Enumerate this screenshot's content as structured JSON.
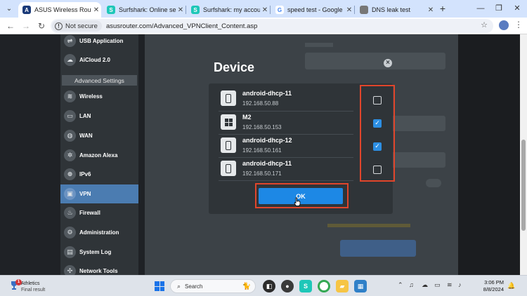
{
  "browser": {
    "tabs": [
      {
        "title": "ASUS Wireless Router RT",
        "active": true,
        "fav_color": "#1a3a78",
        "fav_text": "A"
      },
      {
        "title": "Surfshark: Online securit",
        "active": false,
        "fav_color": "#1ec7b8",
        "fav_text": "S"
      },
      {
        "title": "Surfshark: my account",
        "active": false,
        "fav_color": "#1ec7b8",
        "fav_text": "S"
      },
      {
        "title": "speed test - Google Sea",
        "active": false,
        "fav_color": "#4285f4",
        "fav_text": "G"
      },
      {
        "title": "DNS leak test",
        "active": false,
        "fav_color": "#777777",
        "fav_text": ""
      }
    ],
    "not_secure_label": "Not secure",
    "url": "asusrouter.com/Advanced_VPNClient_Content.asp"
  },
  "sidebar": {
    "top_items": [
      {
        "label": "USB Application",
        "icon": "usb-icon"
      },
      {
        "label": "AiCloud 2.0",
        "icon": "cloud-icon"
      }
    ],
    "advanced_header": "Advanced Settings",
    "items": [
      {
        "label": "Wireless",
        "icon": "wifi-icon",
        "active": false
      },
      {
        "label": "LAN",
        "icon": "lan-icon",
        "active": false
      },
      {
        "label": "WAN",
        "icon": "globe-icon",
        "active": false
      },
      {
        "label": "Amazon Alexa",
        "icon": "alexa-icon",
        "active": false
      },
      {
        "label": "IPv6",
        "icon": "ipv6-icon",
        "active": false
      },
      {
        "label": "VPN",
        "icon": "vpn-icon",
        "active": true
      },
      {
        "label": "Firewall",
        "icon": "firewall-icon",
        "active": false
      },
      {
        "label": "Administration",
        "icon": "admin-icon",
        "active": false
      },
      {
        "label": "System Log",
        "icon": "log-icon",
        "active": false
      },
      {
        "label": "Network Tools",
        "icon": "tools-icon",
        "active": false
      }
    ]
  },
  "dialog": {
    "title": "Device",
    "devices": [
      {
        "name": "android-dhcp-11",
        "ip": "192.168.50.88",
        "type": "phone",
        "checked": false
      },
      {
        "name": "M2",
        "ip": "192.168.50.153",
        "type": "windows",
        "checked": true
      },
      {
        "name": "android-dhcp-12",
        "ip": "192.168.50.161",
        "type": "phone",
        "checked": true
      },
      {
        "name": "android-dhcp-11",
        "ip": "192.168.50.171",
        "type": "phone",
        "checked": false
      }
    ],
    "ok_label": "OK"
  },
  "colors": {
    "highlight": "#e0452b",
    "accent": "#1d88e5",
    "active_nav": "#4b7cb1"
  },
  "taskbar": {
    "weather_title": "Athletics",
    "weather_sub": "Final result",
    "weather_badge": "1",
    "search_placeholder": "Search",
    "time": "3:06 PM",
    "date": "8/8/2024"
  }
}
